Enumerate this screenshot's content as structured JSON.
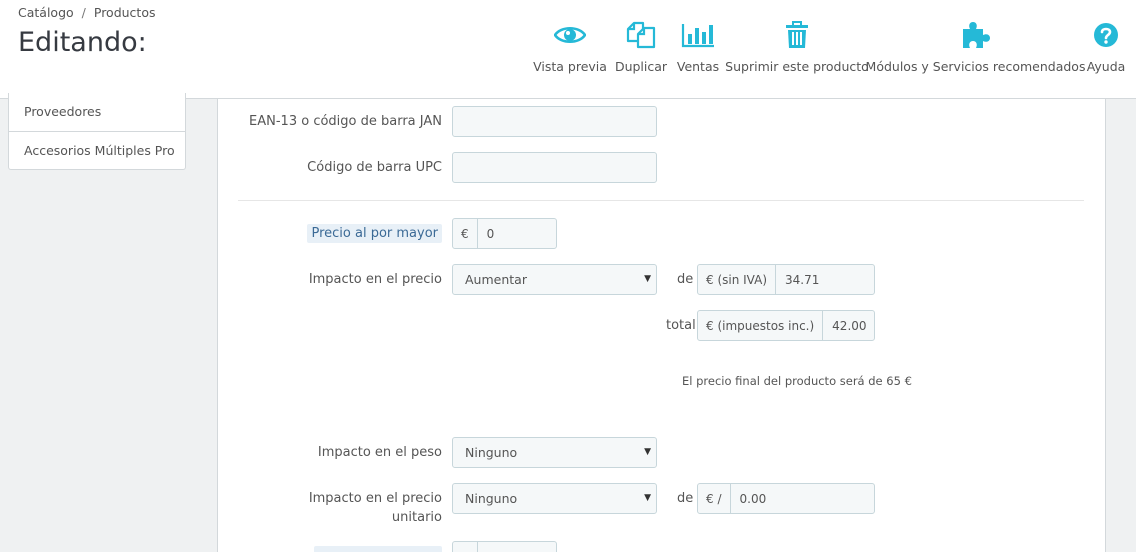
{
  "breadcrumb": {
    "catalog": "Catálogo",
    "separator": "/",
    "products": "Productos"
  },
  "page_title": "Editando:",
  "toolbar": [
    {
      "label": "Vista previa",
      "icon": "eye-icon"
    },
    {
      "label": "Duplicar",
      "icon": "duplicate-icon"
    },
    {
      "label": "Ventas",
      "icon": "bar-chart-icon"
    },
    {
      "label": "Suprimir este producto",
      "icon": "trash-icon"
    },
    {
      "label": "Módulos y Servicios recomendados",
      "icon": "puzzle-icon"
    },
    {
      "label": "Ayuda",
      "icon": "help-icon"
    }
  ],
  "colors": {
    "accent": "#25b9d7",
    "label_highlight_bg": "#e8f0f7"
  },
  "sidebar": {
    "items": [
      {
        "label": "Proveedores"
      },
      {
        "label": "Accesorios Múltiples Pro"
      }
    ]
  },
  "form": {
    "ean13": {
      "label": "EAN-13 o código de barra JAN",
      "value": ""
    },
    "upc": {
      "label": "Código de barra UPC",
      "value": ""
    },
    "wholesale": {
      "label": "Precio al por mayor",
      "currency": "€",
      "value": "0"
    },
    "price_impact": {
      "label": "Impacto en el precio",
      "selected": "Aumentar",
      "de_word": "de",
      "tax_excl_addon": "€ (sin IVA)",
      "tax_excl_value": "34.71",
      "total_word": "total",
      "tax_incl_addon": "€ (impuestos inc.)",
      "tax_incl_value": "42.00",
      "final_note": "El precio final del producto será de 65 €"
    },
    "weight_impact": {
      "label": "Impacto en el peso",
      "selected": "Ninguno"
    },
    "unit_price_impact": {
      "label_line1": "Impacto en el precio",
      "label_line2": "unitario",
      "selected": "Ninguno",
      "de_word": "de",
      "addon": "€ /",
      "value": "0.00"
    }
  }
}
